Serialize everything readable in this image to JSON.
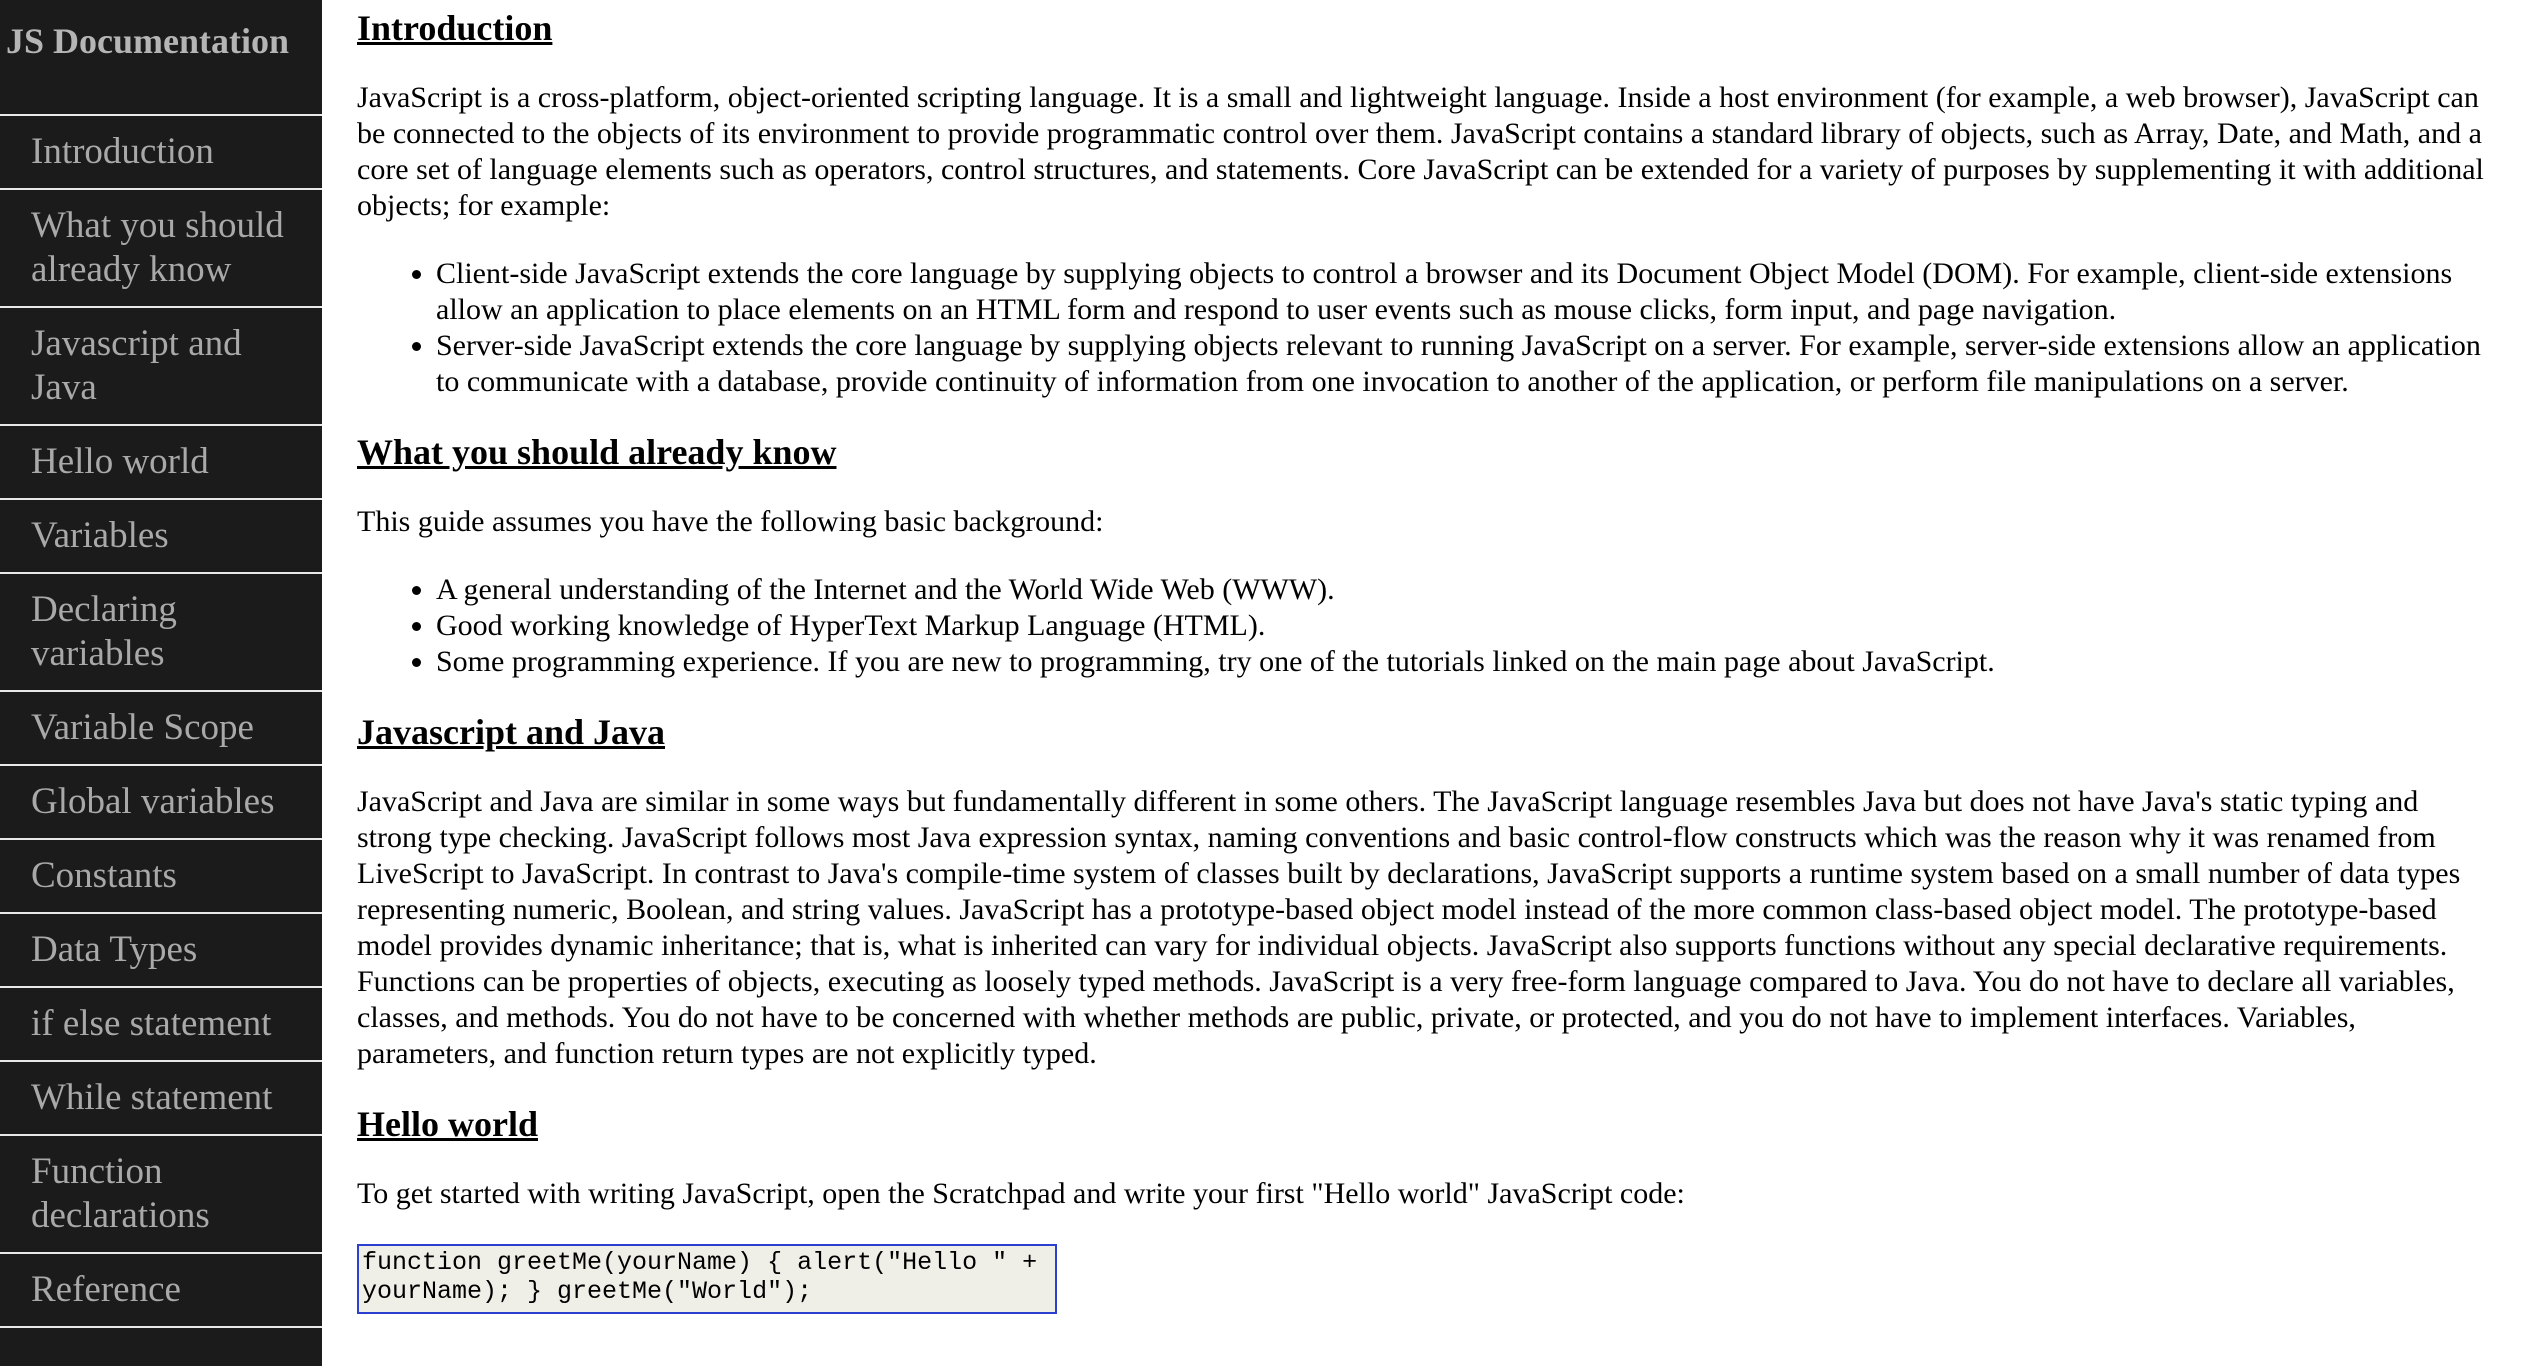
{
  "nav": {
    "title": "JS Documentation",
    "items": [
      {
        "label": "Introduction"
      },
      {
        "label": "What you should already know"
      },
      {
        "label": "Javascript and Java"
      },
      {
        "label": "Hello world"
      },
      {
        "label": "Variables"
      },
      {
        "label": "Declaring variables"
      },
      {
        "label": "Variable Scope"
      },
      {
        "label": "Global variables"
      },
      {
        "label": "Constants"
      },
      {
        "label": "Data Types"
      },
      {
        "label": "if else statement"
      },
      {
        "label": "While statement"
      },
      {
        "label": "Function declarations"
      },
      {
        "label": "Reference"
      }
    ]
  },
  "sections": {
    "introduction": {
      "heading": "Introduction",
      "paragraph": "JavaScript is a cross-platform, object-oriented scripting language. It is a small and lightweight language. Inside a host environment (for example, a web browser), JavaScript can be connected to the objects of its environment to provide programmatic control over them. JavaScript contains a standard library of objects, such as Array, Date, and Math, and a core set of language elements such as operators, control structures, and statements. Core JavaScript can be extended for a variety of purposes by supplementing it with additional objects; for example:",
      "list": [
        "Client-side JavaScript extends the core language by supplying objects to control a browser and its Document Object Model (DOM). For example, client-side extensions allow an application to place elements on an HTML form and respond to user events such as mouse clicks, form input, and page navigation.",
        "Server-side JavaScript extends the core language by supplying objects relevant to running JavaScript on a server. For example, server-side extensions allow an application to communicate with a database, provide continuity of information from one invocation to another of the application, or perform file manipulations on a server."
      ]
    },
    "what_you_should_know": {
      "heading": "What you should already know",
      "paragraph": "This guide assumes you have the following basic background:",
      "list": [
        "A general understanding of the Internet and the World Wide Web (WWW).",
        "Good working knowledge of HyperText Markup Language (HTML).",
        "Some programming experience. If you are new to programming, try one of the tutorials linked on the main page about JavaScript."
      ]
    },
    "javascript_and_java": {
      "heading": "Javascript and Java",
      "paragraph": "JavaScript and Java are similar in some ways but fundamentally different in some others. The JavaScript language resembles Java but does not have Java's static typing and strong type checking. JavaScript follows most Java expression syntax, naming conventions and basic control-flow constructs which was the reason why it was renamed from LiveScript to JavaScript. In contrast to Java's compile-time system of classes built by declarations, JavaScript supports a runtime system based on a small number of data types representing numeric, Boolean, and string values. JavaScript has a prototype-based object model instead of the more common class-based object model. The prototype-based model provides dynamic inheritance; that is, what is inherited can vary for individual objects. JavaScript also supports functions without any special declarative requirements. Functions can be properties of objects, executing as loosely typed methods. JavaScript is a very free-form language compared to Java. You do not have to declare all variables, classes, and methods. You do not have to be concerned with whether methods are public, private, or protected, and you do not have to implement interfaces. Variables, parameters, and function return types are not explicitly typed."
    },
    "hello_world": {
      "heading": "Hello world",
      "paragraph": "To get started with writing JavaScript, open the Scratchpad and write your first \"Hello world\" JavaScript code:",
      "code": "function greetMe(yourName) { alert(\"Hello \" + yourName); } greetMe(\"World\");"
    }
  }
}
